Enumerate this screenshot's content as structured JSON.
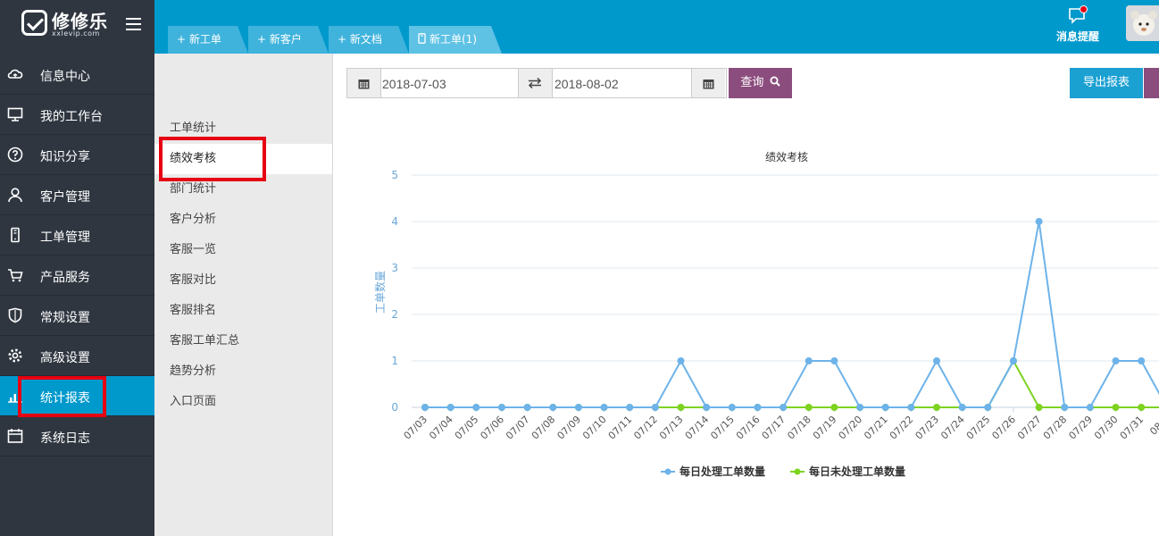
{
  "app": {
    "logo_text": "修修乐",
    "logo_sub": "xxlevip.com"
  },
  "nav": {
    "items": [
      {
        "label": "信息中心",
        "icon": "cloud-icon"
      },
      {
        "label": "我的工作台",
        "icon": "monitor-icon"
      },
      {
        "label": "知识分享",
        "icon": "question-icon"
      },
      {
        "label": "客户管理",
        "icon": "user-icon"
      },
      {
        "label": "工单管理",
        "icon": "phone-icon"
      },
      {
        "label": "产品服务",
        "icon": "cart-icon"
      },
      {
        "label": "常规设置",
        "icon": "shield-icon"
      },
      {
        "label": "高级设置",
        "icon": "gear-icon"
      },
      {
        "label": "统计报表",
        "icon": "bar-chart-icon",
        "active": true
      },
      {
        "label": "系统日志",
        "icon": "calendar-icon"
      }
    ]
  },
  "tabs": [
    {
      "label": "+ 新工单"
    },
    {
      "label": "+ 新客户"
    },
    {
      "label": "+ 新文档"
    },
    {
      "label": "新工单(1)",
      "icon": "phone-icon",
      "current": true
    }
  ],
  "header": {
    "message_label": "消息提醒",
    "badge_color": "#e60012"
  },
  "subnav": {
    "items": [
      "工单统计",
      "绩效考核",
      "部门统计",
      "客户分析",
      "客服一览",
      "客服对比",
      "客服排名",
      "客服工单汇总",
      "趋势分析",
      "入口页面"
    ],
    "active_index": 1
  },
  "filter": {
    "start_date": "2018-07-03",
    "end_date": "2018-08-02",
    "query_label": "查询",
    "export_label": "导出报表"
  },
  "colors": {
    "primary": "#0099cc",
    "nav_bg": "#2f3640",
    "query_btn": "#8b4d7e",
    "highlight": "#e60012"
  },
  "chart_data": {
    "type": "line",
    "title": "绩效考核",
    "xlabel": "",
    "ylabel": "工单数量",
    "ylim": [
      0,
      5
    ],
    "yticks": [
      0,
      1,
      2,
      3,
      4,
      5
    ],
    "grid": true,
    "legend_position": "bottom",
    "categories": [
      "07/03",
      "07/04",
      "07/05",
      "07/06",
      "07/07",
      "07/08",
      "07/09",
      "07/10",
      "07/11",
      "07/12",
      "07/13",
      "07/14",
      "07/15",
      "07/16",
      "07/17",
      "07/18",
      "07/19",
      "07/20",
      "07/21",
      "07/22",
      "07/23",
      "07/24",
      "07/25",
      "07/26",
      "07/27",
      "07/28",
      "07/29",
      "07/30",
      "07/31",
      "08/0"
    ],
    "series": [
      {
        "name": "每日处理工单数量",
        "color": "#6db3ea",
        "values": [
          0,
          0,
          0,
          0,
          0,
          0,
          0,
          0,
          0,
          0,
          1,
          0,
          0,
          0,
          0,
          1,
          1,
          0,
          0,
          0,
          1,
          0,
          0,
          1,
          4,
          0,
          0,
          1,
          1,
          0
        ]
      },
      {
        "name": "每日未处理工单数量",
        "color": "#7ed321",
        "values": [
          0,
          0,
          0,
          0,
          0,
          0,
          0,
          0,
          0,
          0,
          0,
          0,
          0,
          0,
          0,
          0,
          0,
          0,
          0,
          0,
          0,
          0,
          0,
          1,
          0,
          0,
          0,
          0,
          0,
          0
        ]
      }
    ]
  }
}
